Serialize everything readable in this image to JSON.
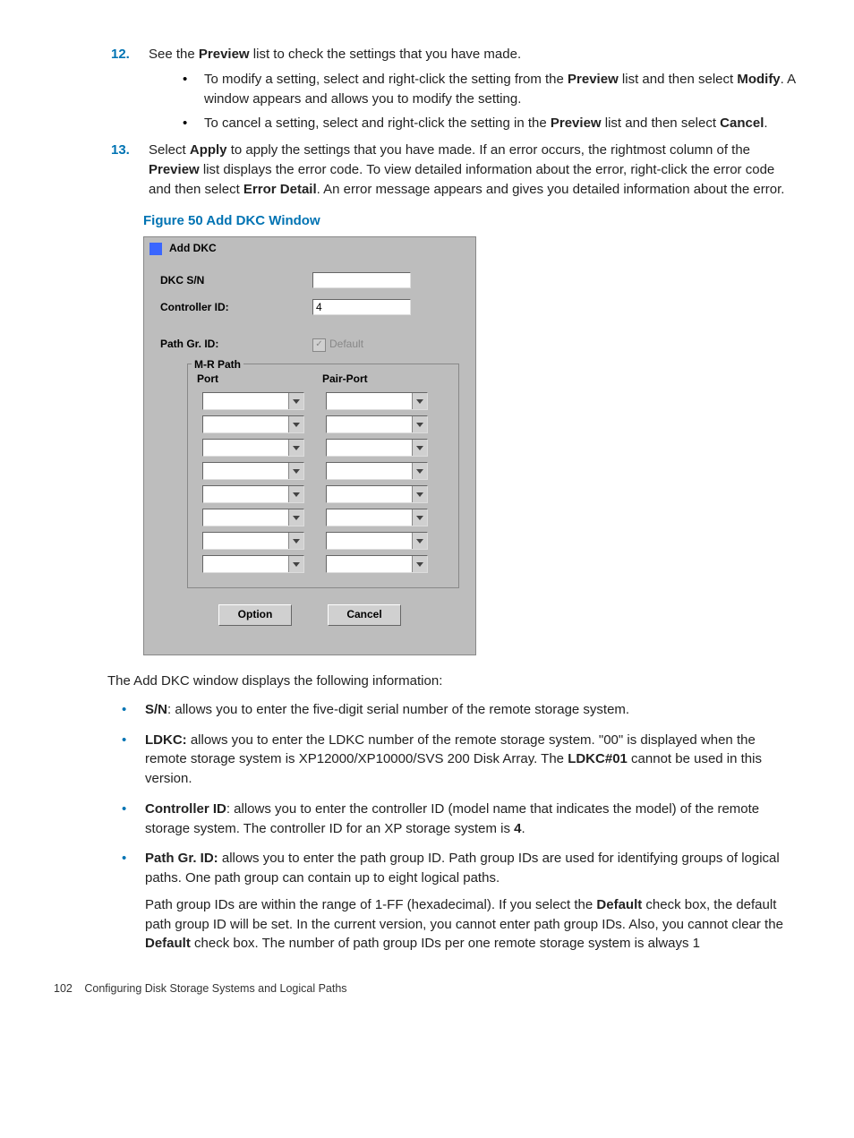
{
  "steps": {
    "s12": {
      "num": "12.",
      "lead": "See the ",
      "b1": "Preview",
      "tail": " list to check the settings that you have made.",
      "sub1": {
        "a": "To modify a setting, select and right-click the setting from the ",
        "b": "Preview",
        "c": " list and then select ",
        "d": "Modify",
        "e": ". A window appears and allows you to modify the setting."
      },
      "sub2": {
        "a": "To cancel a setting, select and right-click the setting in the ",
        "b": "Preview",
        "c": " list and then select ",
        "d": "Cancel",
        "e": "."
      }
    },
    "s13": {
      "num": "13.",
      "a": "Select ",
      "b": "Apply",
      "c": " to apply the settings that you have made. If an error occurs, the rightmost column of the ",
      "d": "Preview",
      "e": " list displays the error code. To view detailed information about the error, right-click the error code and then select ",
      "f": "Error Detail",
      "g": ". An error message appears and gives you detailed information about the error."
    }
  },
  "figure_caption": "Figure 50 Add DKC Window",
  "dialog": {
    "title": "Add DKC",
    "dkc_sn_label": "DKC S/N",
    "dkc_sn_value": "",
    "controller_id_label": "Controller ID:",
    "controller_id_value": "4",
    "path_gr_label": "Path Gr. ID:",
    "default_chk_label": "Default",
    "mr_legend": "M-R Path",
    "col_port": "Port",
    "col_pair": "Pair-Port",
    "btn_option": "Option",
    "btn_cancel": "Cancel"
  },
  "intro_after_fig": "The Add DKC window displays the following information:",
  "defs": {
    "sn": {
      "b": "S/N",
      "t": ": allows you to enter the five-digit serial number of the remote storage system."
    },
    "ldkc": {
      "b": "LDKC:",
      "t1": " allows you to enter the LDKC number of the remote storage system. \"00\" is displayed when the remote storage system is XP12000/XP10000/SVS 200 Disk Array. The ",
      "b2": "LDKC#01",
      "t2": " cannot be used in this version."
    },
    "cid": {
      "b": "Controller ID",
      "t1": ": allows you to enter the controller ID (model name that indicates the model) of the remote storage system. The controller ID for an XP storage system is ",
      "b2": "4",
      "t2": "."
    },
    "pg": {
      "b": "Path Gr. ID:",
      "t": " allows you to enter the path group ID. Path group IDs are used for identifying groups of logical paths. One path group can contain up to eight logical paths.",
      "p2a": "Path group IDs are within the range of 1-FF (hexadecimal). If you select the ",
      "p2b": "Default",
      "p2c": " check box, the default path group ID will be set. In the current version, you cannot enter path group IDs. Also, you cannot clear the ",
      "p2d": "Default",
      "p2e": " check box. The number of path group IDs per one remote storage system is always 1"
    }
  },
  "footer": {
    "page": "102",
    "section": "Configuring Disk Storage Systems and Logical Paths"
  }
}
